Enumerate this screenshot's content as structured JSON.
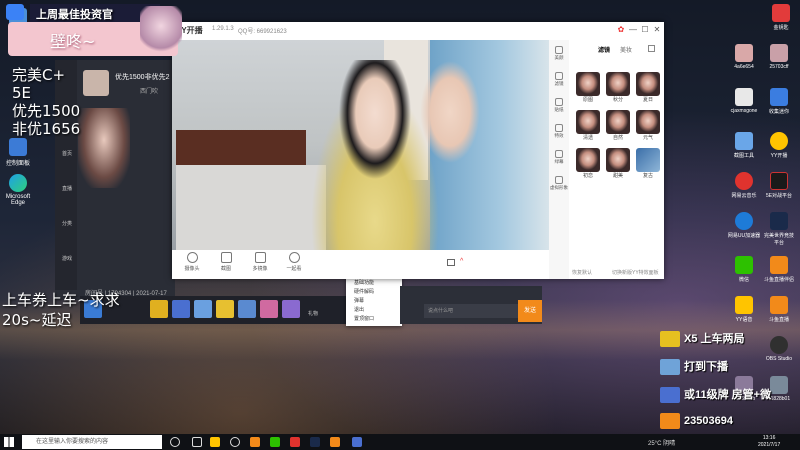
{
  "overlays": {
    "top_banner": "上周最佳投资官",
    "name": "壁咚~",
    "left_lines": [
      "完美C+",
      "5E",
      "优先1500",
      "非优1656"
    ],
    "bottom_lines": [
      "上车券上车~求求",
      "20s~延迟"
    ]
  },
  "desktop_left_icons": [
    {
      "label": "控制面板"
    },
    {
      "label": "Microsoft Edge"
    }
  ],
  "bg_window": {
    "title": "优先1500非优先2",
    "subtitle": "西门吹",
    "avatar_label": "壁咚",
    "side_items": [
      "首页",
      "直播",
      "分类",
      "游戏"
    ],
    "room_info": "房间号 | 1794304 | 2021-07-17"
  },
  "gift_bar": {
    "label": "礼物"
  },
  "context_menu": {
    "items": [
      "基础功能",
      "硬件解码",
      "弹幕",
      "退出",
      "置顶窗口"
    ]
  },
  "chat": {
    "placeholder": "说点什么吧",
    "send_label": "发送"
  },
  "yy_window": {
    "logo": "YY开播",
    "version": "1.29.1.3",
    "qid": "QQ号: 669921623",
    "controls": {
      "skin": "✿",
      "minimize": "—",
      "maximize": "☐",
      "close": "✕"
    }
  },
  "camera_toolbar": {
    "items": [
      {
        "label": "摄像头"
      },
      {
        "label": "截图"
      },
      {
        "label": "多镜像"
      },
      {
        "label": "一起看"
      }
    ]
  },
  "effects_panel": {
    "tabs": [
      "滤镜",
      "美妆"
    ],
    "active_tab": "滤镜",
    "side_items": [
      "美颜",
      "滤镜",
      "贴纸",
      "特效",
      "绿幕",
      "虚拟形象"
    ],
    "items": [
      {
        "label": "原图"
      },
      {
        "label": "秋分"
      },
      {
        "label": "夏日"
      },
      {
        "label": "清透"
      },
      {
        "label": "自然"
      },
      {
        "label": "元气"
      },
      {
        "label": "初恋"
      },
      {
        "label": "甜美"
      },
      {
        "label": "复古"
      }
    ],
    "footer_left": "恢复默认",
    "footer_right": "切换新版YY特效面板"
  },
  "desktop_right_icons": [
    {
      "label": "金钥匙"
    },
    {
      "label": "4a6e654"
    },
    {
      "label": "25703cff"
    },
    {
      "label": "cjaxmsgone"
    },
    {
      "label": "收集迷你"
    },
    {
      "label": "截图工具"
    },
    {
      "label": "YY开播"
    },
    {
      "label": "网易云音乐"
    },
    {
      "label": "5E对战平台"
    },
    {
      "label": "网易UU加速器"
    },
    {
      "label": "完美世界竞技平台"
    },
    {
      "label": "微信"
    },
    {
      "label": "斗鱼直播伴侣"
    },
    {
      "label": "YY语音"
    },
    {
      "label": "斗鱼直播"
    },
    {
      "label": "OBS Studio"
    },
    {
      "label": "9656f8efb"
    },
    {
      "label": "41828b01"
    }
  ],
  "ticker": {
    "rows": [
      "X5 上车两局",
      "打到下播",
      "或11级牌 房管+微",
      "23503694"
    ]
  },
  "taskbar": {
    "search_placeholder": "在这里输入你要搜索的内容",
    "temperature": "25°C 阴晴",
    "time": "13:16",
    "date": "2021/7/17"
  },
  "colors": {
    "accent": "#f28a1a",
    "brand": "#ffc400"
  }
}
